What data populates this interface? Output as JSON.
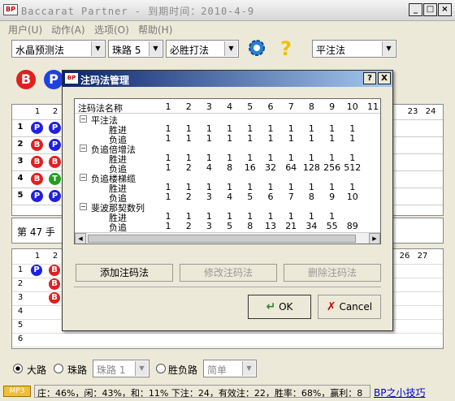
{
  "window": {
    "title": "Baccarat Partner - 到期时间：2010-4-9",
    "icon_text": "BP"
  },
  "menu": [
    "用户(U)",
    "动作(A)",
    "选项(O)",
    "帮助(H)"
  ],
  "toolbar": {
    "combo1": "水晶预测法",
    "combo2": "珠路 5",
    "combo3": "必胜打法",
    "combo4": "平注法"
  },
  "left_panel": {
    "circles": [
      {
        "letter": "B",
        "color": "#e02020"
      },
      {
        "letter": "P",
        "color": "#2040e0"
      }
    ],
    "col_headers": [
      "1",
      "2"
    ],
    "row_headers": [
      "1",
      "2",
      "3",
      "4",
      "5"
    ],
    "beads": [
      [
        {
          "l": "P",
          "c": "#2020e0"
        },
        {
          "l": "P",
          "c": "#2020e0"
        }
      ],
      [
        {
          "l": "B",
          "c": "#e02020"
        },
        {
          "l": "P",
          "c": "#2020e0"
        }
      ],
      [
        {
          "l": "B",
          "c": "#e02020"
        },
        {
          "l": "B",
          "c": "#e02020"
        }
      ],
      [
        {
          "l": "B",
          "c": "#e02020"
        },
        {
          "l": "T",
          "c": "#20a020"
        }
      ],
      [
        {
          "l": "P",
          "c": "#2020e0"
        },
        {
          "l": "P",
          "c": "#2020e0"
        }
      ]
    ],
    "hand_text": "第 47 手"
  },
  "right_top_headers": [
    "23",
    "24"
  ],
  "lower_panel": {
    "col_headers": [
      "1",
      "2"
    ],
    "row_headers": [
      "1",
      "2",
      "3",
      "4",
      "5",
      "6"
    ],
    "beads": [
      [
        {
          "l": "P",
          "c": "#2020e0"
        },
        {
          "l": "B",
          "c": "#e02020"
        }
      ],
      [
        null,
        {
          "l": "B",
          "c": "#e02020"
        }
      ],
      [
        null,
        {
          "l": "B",
          "c": "#e02020"
        }
      ]
    ],
    "right_headers": [
      "26",
      "27"
    ]
  },
  "dialog": {
    "title": "注码法管理",
    "help": "?",
    "close": "X",
    "name_header": "注码法名称",
    "col_headers": [
      "1",
      "2",
      "3",
      "4",
      "5",
      "6",
      "7",
      "8",
      "9",
      "10",
      "11"
    ],
    "groups": [
      {
        "name": "平注法",
        "rows": [
          {
            "label": "胜进",
            "values": [
              "1",
              "1",
              "1",
              "1",
              "1",
              "1",
              "1",
              "1",
              "1",
              "1"
            ]
          },
          {
            "label": "负追",
            "values": [
              "1",
              "1",
              "1",
              "1",
              "1",
              "1",
              "1",
              "1",
              "1",
              "1"
            ]
          }
        ]
      },
      {
        "name": "负追倍增法",
        "rows": [
          {
            "label": "胜进",
            "values": [
              "1",
              "1",
              "1",
              "1",
              "1",
              "1",
              "1",
              "1",
              "1",
              "1"
            ]
          },
          {
            "label": "负追",
            "values": [
              "1",
              "2",
              "4",
              "8",
              "16",
              "32",
              "64",
              "128",
              "256",
              "512"
            ]
          }
        ]
      },
      {
        "name": "负追楼梯缆",
        "rows": [
          {
            "label": "胜进",
            "values": [
              "1",
              "1",
              "1",
              "1",
              "1",
              "1",
              "1",
              "1",
              "1",
              "1"
            ]
          },
          {
            "label": "负追",
            "values": [
              "1",
              "2",
              "3",
              "4",
              "5",
              "6",
              "7",
              "8",
              "9",
              "10"
            ]
          }
        ]
      },
      {
        "name": "斐波那契数列",
        "rows": [
          {
            "label": "胜进",
            "values": [
              "1",
              "1",
              "1",
              "1",
              "1",
              "1",
              "1",
              "1",
              "1"
            ]
          },
          {
            "label": "负追",
            "values": [
              "1",
              "2",
              "3",
              "5",
              "8",
              "13",
              "21",
              "34",
              "55",
              "89"
            ]
          }
        ]
      }
    ],
    "add_button": "添加注码法",
    "edit_button": "修改注码法",
    "delete_button": "删除注码法",
    "ok_button": "OK",
    "cancel_button": "Cancel"
  },
  "bottom_bar": {
    "radio_big": "大路",
    "radio_bead": "珠路",
    "combo_bead": "珠路 1",
    "radio_win": "胜负路",
    "combo_simple": "简单"
  },
  "status": {
    "badge": "MP3",
    "text": "庄：46%，闲：43%，和：11%  下注：24，有效注：22，胜率：68%，赢利：8",
    "link": "BP之小技巧"
  },
  "colors": {
    "banker": "#e02020",
    "player": "#2040e0",
    "tie": "#20a020",
    "dialog_title": "#0a246a"
  }
}
